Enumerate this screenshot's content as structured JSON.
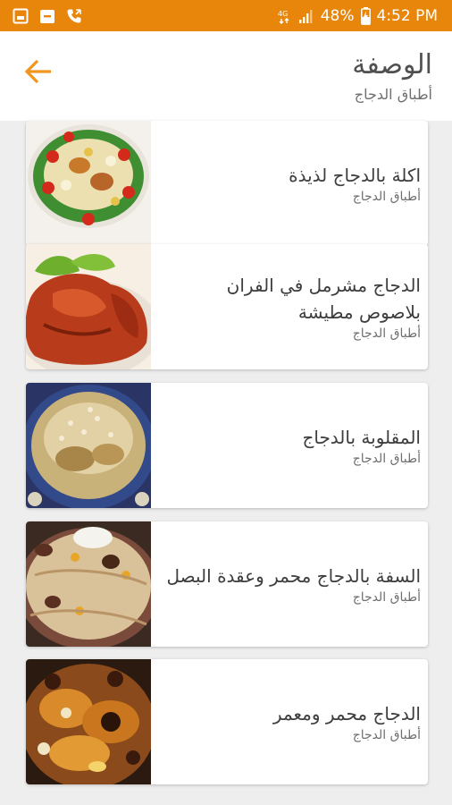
{
  "status_bar": {
    "battery": "48%",
    "time": "4:52 PM",
    "left_icons": [
      "gallery-icon",
      "store-icon",
      "phone-icon"
    ],
    "right_icons": [
      "wifi-4g-icon",
      "signal-icon",
      "battery-icon"
    ],
    "color": "#e8860b"
  },
  "header": {
    "title": "الوصفة",
    "subtitle": "أطباق الدجاج",
    "back_icon": "arrow-left-icon",
    "accent": "#f0961e"
  },
  "recipes": [
    {
      "title": "اكلة بالدجاج لذيذة",
      "category": "أطباق الدجاج"
    },
    {
      "title": "الدجاج مشرمل في الفران بلاصوص مطيشة",
      "category": "أطباق الدجاج"
    },
    {
      "title": "المقلوبة بالدجاج",
      "category": "أطباق الدجاج"
    },
    {
      "title": "السفة بالدجاج محمر وعقدة البصل",
      "category": "أطباق الدجاج"
    },
    {
      "title": "الدجاج محمر ومعمر",
      "category": "أطباق الدجاج"
    }
  ]
}
